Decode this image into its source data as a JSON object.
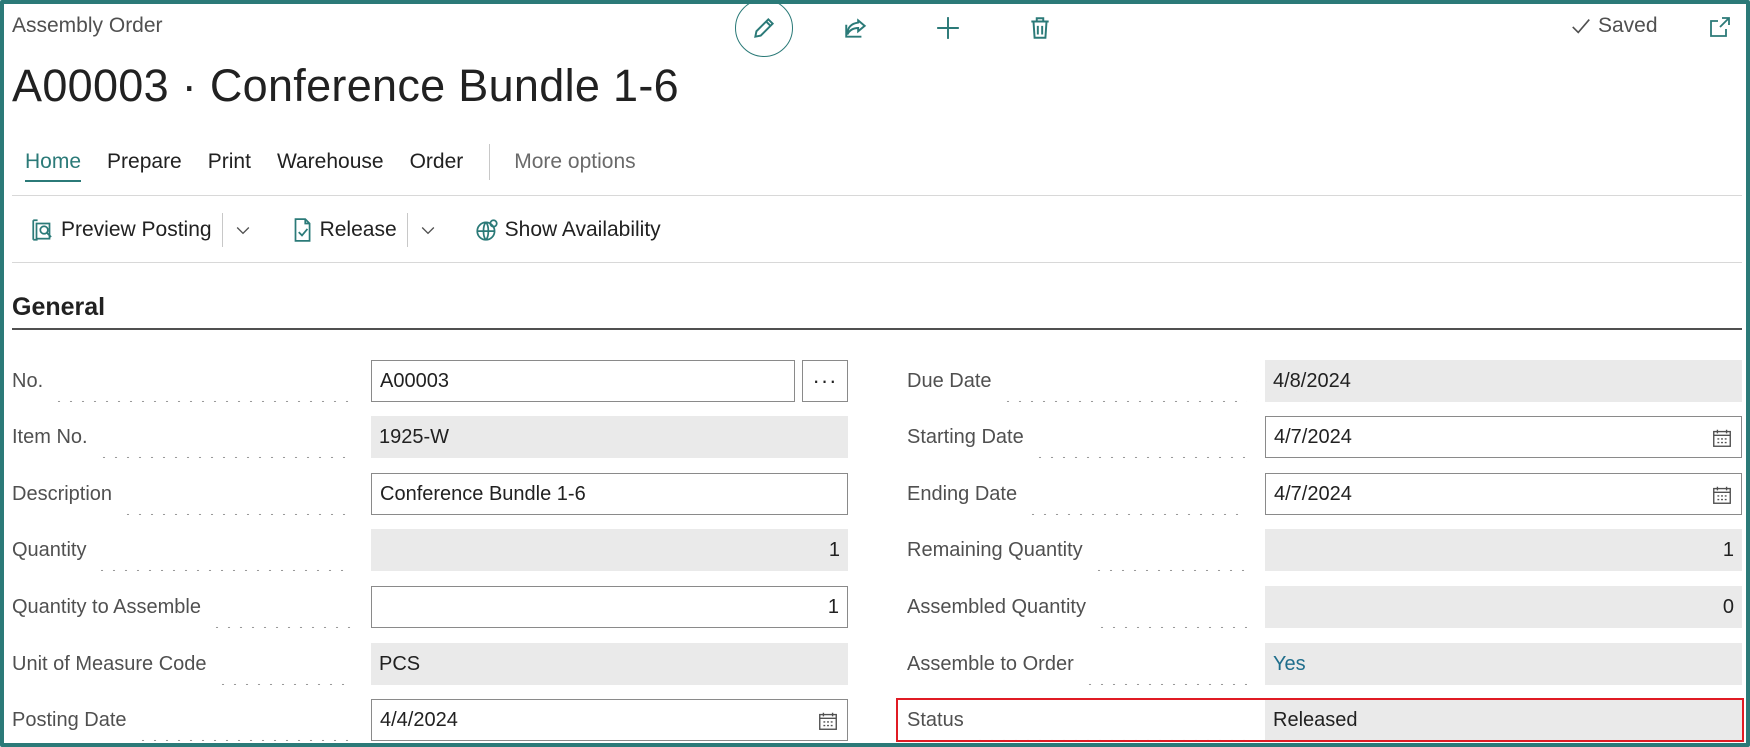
{
  "header": {
    "caption": "Assembly Order",
    "title": "A00003 · Conference Bundle 1-6",
    "saved_label": "Saved"
  },
  "top_actions": [
    {
      "icon": "pencil-icon"
    },
    {
      "icon": "share-icon"
    },
    {
      "icon": "plus-icon"
    },
    {
      "icon": "trash-icon"
    }
  ],
  "tabs": {
    "home": "Home",
    "prepare": "Prepare",
    "print": "Print",
    "warehouse": "Warehouse",
    "order": "Order",
    "more": "More options"
  },
  "actions": {
    "preview_posting": "Preview Posting",
    "release": "Release",
    "show_availability": "Show Availability"
  },
  "section": {
    "title": "General"
  },
  "fields_left": {
    "no": {
      "label": "No.",
      "value": "A00003"
    },
    "item_no": {
      "label": "Item No.",
      "value": "1925-W"
    },
    "description": {
      "label": "Description",
      "value": "Conference Bundle 1-6"
    },
    "quantity": {
      "label": "Quantity",
      "value": "1"
    },
    "quantity_to_assemble": {
      "label": "Quantity to Assemble",
      "value": "1"
    },
    "uom": {
      "label": "Unit of Measure Code",
      "value": "PCS"
    },
    "posting_date": {
      "label": "Posting Date",
      "value": "4/4/2024"
    }
  },
  "fields_right": {
    "due_date": {
      "label": "Due Date",
      "value": "4/8/2024"
    },
    "starting_date": {
      "label": "Starting Date",
      "value": "4/7/2024"
    },
    "ending_date": {
      "label": "Ending Date",
      "value": "4/7/2024"
    },
    "remaining_quantity": {
      "label": "Remaining Quantity",
      "value": "1"
    },
    "assembled_quantity": {
      "label": "Assembled Quantity",
      "value": "0"
    },
    "assemble_to_order": {
      "label": "Assemble to Order",
      "value": "Yes"
    },
    "status": {
      "label": "Status",
      "value": "Released"
    }
  },
  "colors": {
    "accent": "#2b7a78",
    "highlight": "#e01b24",
    "readonly_bg": "#eaeaea"
  }
}
